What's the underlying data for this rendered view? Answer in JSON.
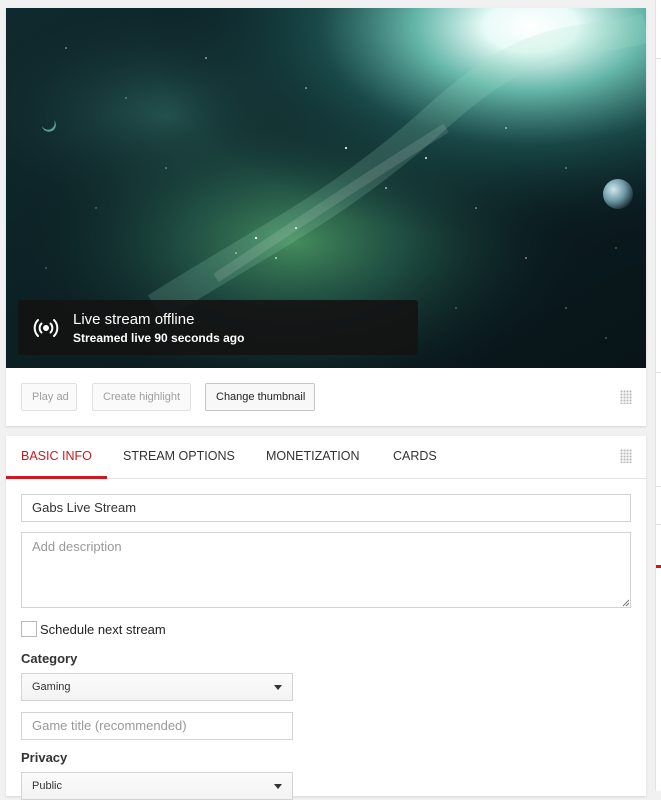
{
  "player": {
    "status_title": "Live stream offline",
    "status_subtitle": "Streamed live 90 seconds ago",
    "status_icon": "live-broadcast-icon"
  },
  "actions": {
    "play_ad": "Play ad",
    "create_highlight": "Create highlight",
    "change_thumbnail": "Change thumbnail"
  },
  "tabs": [
    {
      "label": "BASIC INFO",
      "active": true
    },
    {
      "label": "STREAM OPTIONS",
      "active": false
    },
    {
      "label": "MONETIZATION",
      "active": false
    },
    {
      "label": "CARDS",
      "active": false
    }
  ],
  "form": {
    "title_value": "Gabs Live Stream",
    "description_placeholder": "Add description",
    "schedule_label": "Schedule next stream",
    "schedule_checked": false,
    "category_label": "Category",
    "category_value": "Gaming",
    "game_title_placeholder": "Game title (recommended)",
    "privacy_label": "Privacy",
    "privacy_value": "Public"
  },
  "colors": {
    "accent": "#cc181e",
    "overlay": "#141414"
  }
}
